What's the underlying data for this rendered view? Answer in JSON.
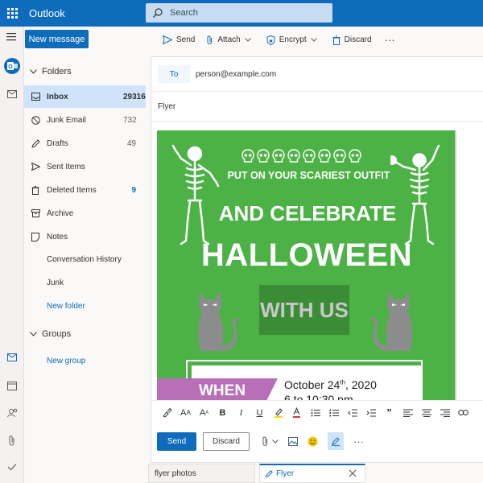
{
  "app": {
    "title": "Outlook"
  },
  "search": {
    "placeholder": "Search"
  },
  "toolbar": {
    "new_message": "New message",
    "send": "Send",
    "attach": "Attach",
    "encrypt": "Encrypt",
    "discard": "Discard",
    "more": "···"
  },
  "folders": {
    "header": "Folders",
    "items": [
      {
        "label": "Inbox",
        "count": "29316"
      },
      {
        "label": "Junk Email",
        "count": "732"
      },
      {
        "label": "Drafts",
        "count": "49"
      },
      {
        "label": "Sent Items",
        "count": ""
      },
      {
        "label": "Deleted Items",
        "count": "9"
      },
      {
        "label": "Archive",
        "count": ""
      },
      {
        "label": "Notes",
        "count": ""
      },
      {
        "label": "Conversation History",
        "count": ""
      },
      {
        "label": "Junk",
        "count": ""
      }
    ],
    "new_folder": "New folder",
    "groups_header": "Groups",
    "new_group": "New group"
  },
  "compose": {
    "to_label": "To",
    "to_value": "person@example.com",
    "subject": "Flyer",
    "send": "Send",
    "discard": "Discard"
  },
  "flyer": {
    "line1": "PUT ON YOUR SCARIEST OUTFIT",
    "line2": "AND CELEBRATE",
    "line3": "HALLOWEEN",
    "line4": "WITH US",
    "when_label": "WHEN",
    "date_main": "October 24",
    "date_sup": "th",
    "date_year": ", 2020",
    "time": "6 to 10:30 pm",
    "colors": {
      "background": "#4cb246",
      "ribbon": "#b86fb8"
    }
  },
  "tabs": [
    {
      "label": "flyer photos"
    },
    {
      "label": "Flyer"
    }
  ],
  "colors": {
    "accent": "#0f6cbd",
    "selected": "#cfe4fa"
  }
}
